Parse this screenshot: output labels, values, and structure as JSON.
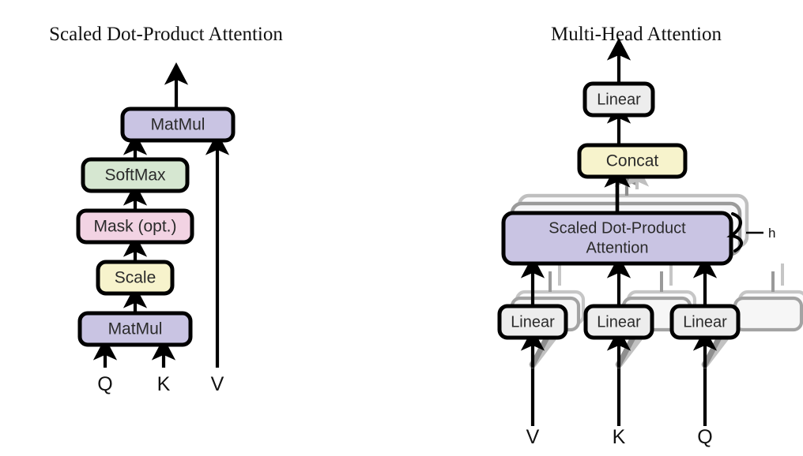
{
  "figure": {
    "left_panel_title": "Scaled Dot-Product Attention",
    "right_panel_title": "Multi-Head Attention"
  },
  "left_panel": {
    "boxes": [
      {
        "label": "MatMul",
        "fill": "#c9c4e3"
      },
      {
        "label": "SoftMax",
        "fill": "#d6e7d1"
      },
      {
        "label": "Mask (opt.)",
        "fill": "#f2d3e3"
      },
      {
        "label": "Scale",
        "fill": "#f7f3cc"
      },
      {
        "label": "MatMul",
        "fill": "#c9c4e3"
      }
    ],
    "inputs": [
      {
        "label": "Q"
      },
      {
        "label": "K"
      },
      {
        "label": "V"
      }
    ]
  },
  "right_panel": {
    "boxes": [
      {
        "label": "Linear",
        "fill": "#ededed"
      },
      {
        "label": "Concat",
        "fill": "#f7f3cc"
      },
      {
        "label": "Scaled Dot-Product",
        "label2": "Attention",
        "fill": "#c9c4e3"
      },
      {
        "label": "Linear",
        "fill": "#ededed"
      },
      {
        "label": "Linear",
        "fill": "#ededed"
      },
      {
        "label": "Linear",
        "fill": "#ededed"
      }
    ],
    "head_count_label": "h",
    "inputs": [
      {
        "label": "V"
      },
      {
        "label": "K"
      },
      {
        "label": "Q"
      }
    ]
  },
  "colors": {
    "stroke": "#000000",
    "ghost_mid": "#8c8c8c",
    "ghost_light": "#bfbfbf",
    "text": "#2b2b2b",
    "background": "#ffffff"
  }
}
